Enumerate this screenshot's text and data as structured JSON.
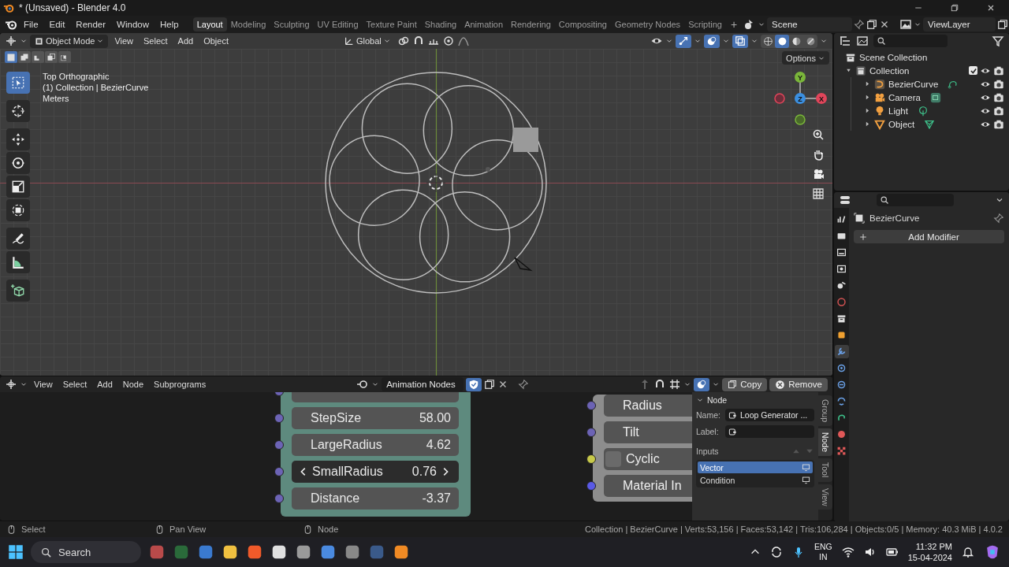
{
  "window": {
    "title": "* (Unsaved) - Blender 4.0"
  },
  "menu": [
    "File",
    "Edit",
    "Render",
    "Window",
    "Help"
  ],
  "workspaces": [
    {
      "label": "Layout",
      "selected": true
    },
    {
      "label": "Modeling",
      "selected": false
    },
    {
      "label": "Sculpting",
      "selected": false
    },
    {
      "label": "UV Editing",
      "selected": false
    },
    {
      "label": "Texture Paint",
      "selected": false
    },
    {
      "label": "Shading",
      "selected": false
    },
    {
      "label": "Animation",
      "selected": false
    },
    {
      "label": "Rendering",
      "selected": false
    },
    {
      "label": "Compositing",
      "selected": false
    },
    {
      "label": "Geometry Nodes",
      "selected": false
    },
    {
      "label": "Scripting",
      "selected": false
    }
  ],
  "add_workspace": "+",
  "scene": {
    "value": "Scene"
  },
  "view_layer": {
    "value": "ViewLayer"
  },
  "viewport": {
    "mode": "Object Mode",
    "menus": [
      "View",
      "Select",
      "Add",
      "Object"
    ],
    "orientation": "Global",
    "options": "Options",
    "select_modes": [
      {
        "kind": "set",
        "selected": true
      },
      {
        "kind": "extend",
        "selected": false
      },
      {
        "kind": "subtract",
        "selected": false
      },
      {
        "kind": "invert",
        "selected": false
      },
      {
        "kind": "intersect",
        "selected": false
      }
    ],
    "toggles": [
      {
        "kind": "gizmo",
        "on": true
      },
      {
        "kind": "overlay",
        "on": true
      },
      {
        "kind": "xray",
        "on": true
      }
    ],
    "shading": [
      {
        "kind": "wireframe",
        "selected": false
      },
      {
        "kind": "solid",
        "selected": true
      },
      {
        "kind": "material",
        "selected": false
      },
      {
        "kind": "rendered",
        "selected": false
      }
    ],
    "overlay_text": [
      "Top Orthographic",
      "(1) Collection | BezierCurve",
      "Meters"
    ],
    "gizmo_labels": [
      "Y",
      "Z",
      "X"
    ],
    "tools": [
      {
        "kind": "select",
        "selected": true
      },
      {
        "kind": "cursor",
        "selected": false
      },
      {
        "kind": "move",
        "selected": false
      },
      {
        "kind": "rotate",
        "selected": false
      },
      {
        "kind": "scale",
        "selected": false
      },
      {
        "kind": "transform",
        "selected": false
      },
      {
        "kind": "annotate",
        "selected": false
      },
      {
        "kind": "measure",
        "selected": false
      },
      {
        "kind": "add-cube",
        "selected": false
      }
    ]
  },
  "node_editor": {
    "menus": [
      "View",
      "Select",
      "Add",
      "Node",
      "Subprograms"
    ],
    "tree_name": "Animation Nodes",
    "copy": "Copy",
    "remove": "Remove",
    "left_node": {
      "rows": [
        {
          "label": "StepSize",
          "value": "58.00",
          "selected": false
        },
        {
          "label": "LargeRadius",
          "value": "4.62",
          "selected": false
        },
        {
          "label": "SmallRadius",
          "value": "0.76",
          "selected": true
        },
        {
          "label": "Distance",
          "value": "-3.37",
          "selected": false
        }
      ]
    },
    "right_node": {
      "rows": [
        {
          "label": "Radius",
          "kind": "field",
          "color": "#6c63b5"
        },
        {
          "label": "Tilt",
          "kind": "field",
          "color": "#6c63b5"
        },
        {
          "label": "Cyclic",
          "kind": "checkbox",
          "color": "#c7c94a",
          "checked": false
        },
        {
          "label": "Material In",
          "kind": "field",
          "color": "#5a5ae6"
        }
      ]
    },
    "sidebar": {
      "tabs": [
        {
          "label": "Group",
          "selected": false
        },
        {
          "label": "Node",
          "selected": true
        },
        {
          "label": "Tool",
          "selected": false
        },
        {
          "label": "View",
          "selected": false
        }
      ],
      "panel_title": "Node",
      "name_label": "Name:",
      "name_value": "Loop Generator ...",
      "label_label": "Label:",
      "inputs_title": "Inputs",
      "inputs": [
        {
          "label": "Vector",
          "selected": true
        },
        {
          "label": "Condition",
          "selected": false
        }
      ]
    }
  },
  "outliner": {
    "tree": [
      {
        "label": "Scene Collection",
        "kind": "scene",
        "children": [
          {
            "label": "Collection",
            "kind": "collection",
            "expanded": true,
            "checked": true,
            "children": [
              {
                "label": "BezierCurve",
                "kind": "curve",
                "expanded": false
              },
              {
                "label": "Camera",
                "kind": "camera",
                "expanded": false
              },
              {
                "label": "Light",
                "kind": "light",
                "expanded": false
              },
              {
                "label": "Object",
                "kind": "mesh",
                "expanded": false
              }
            ]
          }
        ]
      }
    ]
  },
  "properties": {
    "object_name": "BezierCurve",
    "add_modifier": "Add Modifier",
    "tabs": [
      {
        "kind": "tool",
        "selected": false
      },
      {
        "kind": "render",
        "selected": false
      },
      {
        "kind": "output",
        "selected": false
      },
      {
        "kind": "view",
        "selected": false
      },
      {
        "kind": "scene",
        "selected": false
      },
      {
        "kind": "world",
        "selected": false
      },
      {
        "kind": "collection",
        "selected": false
      },
      {
        "kind": "object",
        "selected": false
      },
      {
        "kind": "modifiers",
        "selected": true
      },
      {
        "kind": "particles",
        "selected": false
      },
      {
        "kind": "physics",
        "selected": false
      },
      {
        "kind": "constraints",
        "selected": false
      },
      {
        "kind": "data",
        "selected": false
      },
      {
        "kind": "material",
        "selected": false
      },
      {
        "kind": "texture",
        "selected": false
      }
    ]
  },
  "status_bar": {
    "hints": [
      "Select",
      "Pan View",
      "Node"
    ],
    "stats": "Collection | BezierCurve | Verts:53,156 | Faces:53,142 | Tris:106,284 | Objects:0/5 | Memory: 40.3 MiB | 4.0.2"
  },
  "taskbar": {
    "search": "Search",
    "language": [
      "ENG",
      "IN"
    ],
    "time": "11:32 PM",
    "date": "15-04-2024"
  }
}
